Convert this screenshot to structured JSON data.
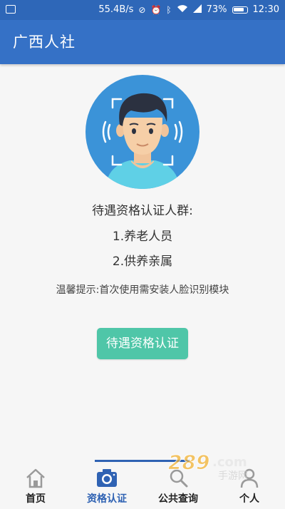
{
  "status_bar": {
    "net_speed": "55.4B/s",
    "battery_percent": "73%",
    "time": "12:30",
    "icons": [
      "notification-icon",
      "alarm-off-icon",
      "alarm-icon",
      "bluetooth-icon",
      "wifi-icon",
      "signal-icon",
      "battery-icon"
    ]
  },
  "app_bar": {
    "title": "广西人社"
  },
  "main": {
    "line1": "待遇资格认证人群:",
    "line2": "1.养老人员",
    "line3": "2.供养亲属",
    "tip": "温馨提示:首次使用需安装人脸识别模块",
    "button_label": "待遇资格认证"
  },
  "bottom_nav": {
    "items": [
      {
        "label": "首页",
        "icon": "home-icon"
      },
      {
        "label": "资格认证",
        "icon": "camera-icon"
      },
      {
        "label": "公共查询",
        "icon": "search-icon"
      },
      {
        "label": "个人",
        "icon": "person-icon"
      }
    ],
    "active_index": 1
  },
  "watermark": {
    "text": "289.com",
    "subtext": "手游网"
  },
  "colors": {
    "status_bar": "#2e67b8",
    "app_bar": "#3571c6",
    "button": "#4fc6a8",
    "accent": "#2f62b3",
    "avatar_bg": "#3b93d8"
  }
}
